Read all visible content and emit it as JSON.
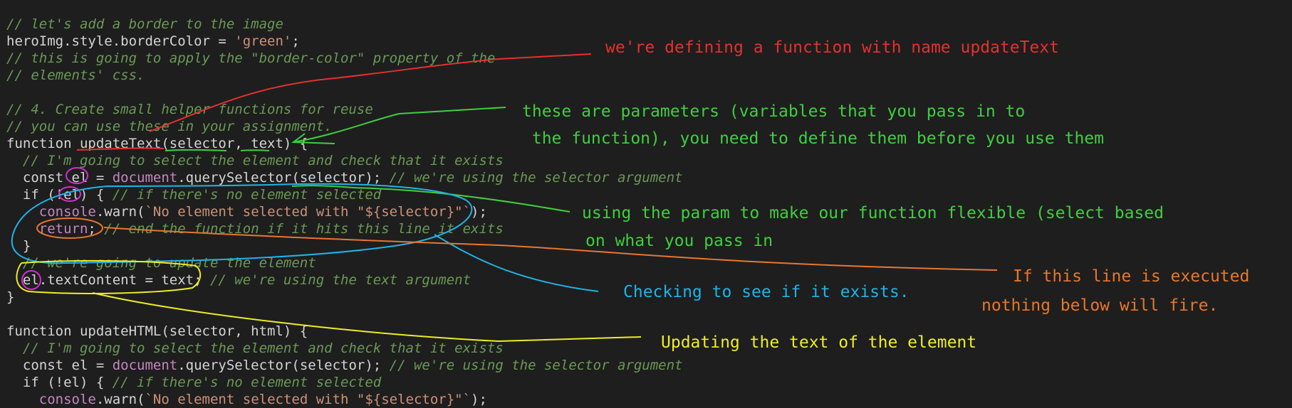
{
  "code_lines": [
    [
      {
        "t": "// let's add a border to the image",
        "c": "comment"
      }
    ],
    [
      {
        "t": "heroImg.style.borderColor = ",
        "c": "plain"
      },
      {
        "t": "'green'",
        "c": "string"
      },
      {
        "t": ";",
        "c": "plain"
      }
    ],
    [
      {
        "t": "// this is going to apply the \"border-color\" property of the",
        "c": "comment"
      }
    ],
    [
      {
        "t": "// elements' css.",
        "c": "comment"
      }
    ],
    [],
    [
      {
        "t": "// 4. Create small helper functions for reuse",
        "c": "comment"
      }
    ],
    [
      {
        "t": "// you can use these in your assignment.",
        "c": "comment"
      }
    ],
    [
      {
        "t": "function updateText(selector, text) {",
        "c": "plain"
      }
    ],
    [
      {
        "t": "  // I'm going to select the element and check that it exists",
        "c": "comment"
      }
    ],
    [
      {
        "t": "  const el = ",
        "c": "plain"
      },
      {
        "t": "document",
        "c": "purple"
      },
      {
        "t": ".querySelector(selector); ",
        "c": "plain"
      },
      {
        "t": "// we're using the selector argument",
        "c": "comment"
      }
    ],
    [
      {
        "t": "  if (!el) { ",
        "c": "plain"
      },
      {
        "t": "// if there's no element selected",
        "c": "comment"
      }
    ],
    [
      {
        "t": "    console",
        "c": "purple"
      },
      {
        "t": ".warn(",
        "c": "plain"
      },
      {
        "t": "`No element selected with \"${selector}\"`",
        "c": "string"
      },
      {
        "t": ");",
        "c": "plain"
      }
    ],
    [
      {
        "t": "    ",
        "c": "plain"
      },
      {
        "t": "return",
        "c": "purple"
      },
      {
        "t": "; ",
        "c": "plain"
      },
      {
        "t": "// end the function if it hits this line it exits",
        "c": "comment"
      }
    ],
    [
      {
        "t": "  }",
        "c": "plain"
      }
    ],
    [
      {
        "t": "  // we're going to update the element",
        "c": "comment"
      }
    ],
    [
      {
        "t": "  el.textContent = text; ",
        "c": "plain"
      },
      {
        "t": "// we're using the text argument",
        "c": "comment"
      }
    ],
    [
      {
        "t": "}",
        "c": "plain"
      }
    ],
    [],
    [
      {
        "t": "function updateHTML(selector, html) {",
        "c": "plain"
      }
    ],
    [
      {
        "t": "  // I'm going to select the element and check that it exists",
        "c": "comment"
      }
    ],
    [
      {
        "t": "  const el = ",
        "c": "plain"
      },
      {
        "t": "document",
        "c": "purple"
      },
      {
        "t": ".querySelector(selector); ",
        "c": "plain"
      },
      {
        "t": "// we're using the selector argument",
        "c": "comment"
      }
    ],
    [
      {
        "t": "  if (!el) { ",
        "c": "plain"
      },
      {
        "t": "// if there's no element selected",
        "c": "comment"
      }
    ],
    [
      {
        "t": "    console",
        "c": "purple"
      },
      {
        "t": ".warn(",
        "c": "plain"
      },
      {
        "t": "`No element selected with \"${selector}\"`",
        "c": "string"
      },
      {
        "t": ");",
        "c": "plain"
      }
    ]
  ],
  "annotations": {
    "function_name": "we're defining a function with name updateText",
    "params_line1": "these are parameters (variables that you pass in to",
    "params_line2": " the function), you need to define them before you use them",
    "param_use_line1": "using the param to make our function flexible (select based",
    "param_use_line2": "on what you pass in",
    "exists_check": "Checking to see if it exists.",
    "return_line1": "If this line is executed",
    "return_line2": "nothing below will fire.",
    "update_text": "Updating the text of the element"
  },
  "colors": {
    "background": "#1e1e1e",
    "code_text": "#d4d4d4",
    "comment": "#6a9955",
    "string": "#ce9178",
    "purple": "#c586c0",
    "ink_red": "#e53030",
    "ink_green": "#3ecf3e",
    "ink_blue": "#1fb3e8",
    "ink_orange": "#e8772a",
    "ink_yellow": "#eeee22",
    "ink_magenta": "#d030d0"
  }
}
